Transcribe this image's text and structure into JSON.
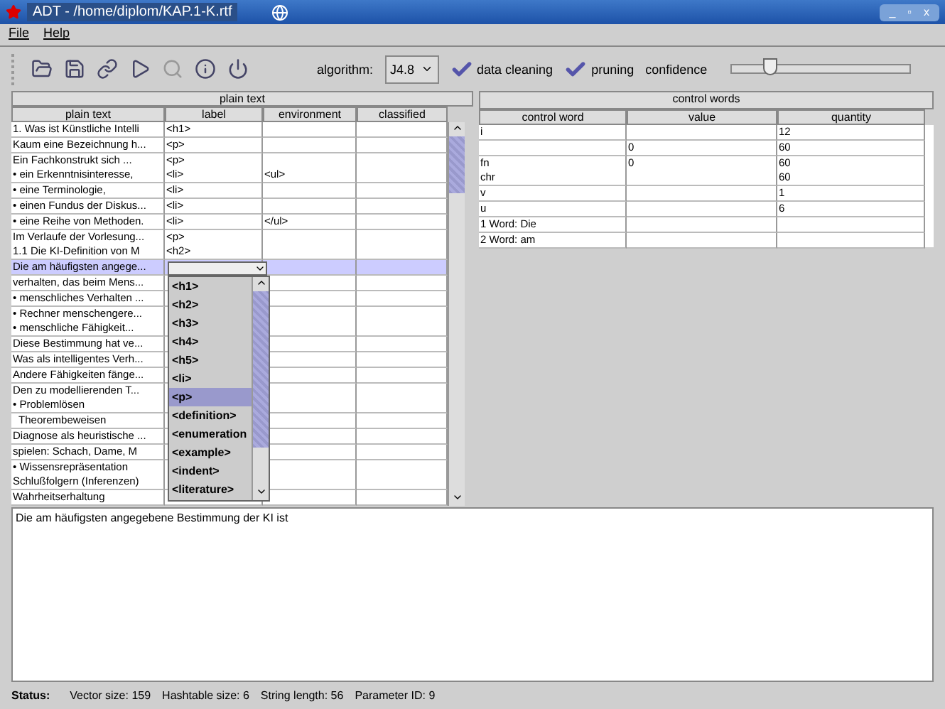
{
  "window": {
    "title": "ADT - /home/diplom/KAP.1-K.rtf",
    "controls": [
      "_",
      "▫",
      "x"
    ]
  },
  "menu": [
    "File",
    "Help"
  ],
  "toolbar": {
    "algorithm_label": "algorithm:",
    "algorithm": "J4.8",
    "options": [
      {
        "label": "data cleaning",
        "checked": true
      },
      {
        "label": "pruning",
        "checked": true
      }
    ],
    "confidence_label": "confidence",
    "confidence": {
      "level": 0.22
    }
  },
  "plain_text_table": {
    "title": "plain text",
    "columns": [
      "plain text",
      "label",
      "environment",
      "classified"
    ],
    "rows": [
      {
        "text": "1. Was ist Künstliche Intelli",
        "label": "<h1>",
        "environment": "",
        "selected": false
      },
      {
        "text": "Kaum eine Bezeichnung h...",
        "label": "<p>",
        "environment": "",
        "selected": false
      },
      {
        "text": "Ein Fachkonstrukt sich ...",
        "label": "<p>",
        "environment": "",
        "selected": false
      },
      {
        "text": "• ein Erkenntnisinteresse,",
        "label": "<li>",
        "environment": "<ul>",
        "selected": false
      },
      {
        "text": "• eine Terminologie,",
        "label": "<li>",
        "environment": "",
        "selected": false
      },
      {
        "text": "• einen Fundus der Diskus...",
        "label": "<li>",
        "environment": "",
        "selected": false
      },
      {
        "text": "• eine Reihe von Methoden.",
        "label": "<li>",
        "environment": "</ul>",
        "selected": false
      },
      {
        "text": "Im Verlaufe der Vorlesung...",
        "label": "<p>",
        "environment": "",
        "selected": false
      },
      {
        "text": "1.1 Die KI-Definition von M",
        "label": "<h2>",
        "environment": "",
        "selected": false
      },
      {
        "text": "Die am häufigsten angege...",
        "label": "",
        "environment": "",
        "selected": true
      },
      {
        "text": "verhalten, das beim Mens...",
        "selected": false
      },
      {
        "text": "• menschliches Verhalten ...",
        "selected": false
      },
      {
        "text": "• Rechner menschengere...",
        "selected": false
      },
      {
        "text": "• menschliche Fähigkeit...",
        "selected": false
      },
      {
        "text": "Diese Bestimmung hat ve...",
        "selected": false
      },
      {
        "text": "Was als intelligentes Verh...",
        "selected": false
      },
      {
        "text": "Andere Fähigkeiten fänge...",
        "selected": false
      },
      {
        "text": "Den zu modellierenden T...",
        "selected": false
      },
      {
        "text": "• Problemlösen",
        "selected": false
      },
      {
        "text": "  Theorembeweisen",
        "selected": false
      },
      {
        "text": "Diagnose als heuristische ...",
        "selected": false
      },
      {
        "text": "spielen: Schach, Dame, M",
        "selected": false
      },
      {
        "text": "• Wissensrepräsentation",
        "selected": false
      },
      {
        "text": "Schlußfolgern (Inferenzen)",
        "selected": false
      },
      {
        "text": "Wahrheitserhaltung",
        "selected": false
      }
    ],
    "label_dropdown": [
      {
        "label": "<h1>",
        "selected": false
      },
      {
        "label": "<h2>",
        "selected": false
      },
      {
        "label": "<h3>",
        "selected": false
      },
      {
        "label": "<h4>",
        "selected": false
      },
      {
        "label": "<h5>",
        "selected": false
      },
      {
        "label": "<li>",
        "selected": false
      },
      {
        "label": "<p>",
        "selected": true
      },
      {
        "label": "<definition>",
        "selected": false
      },
      {
        "label": "<enumeration",
        "selected": false
      },
      {
        "label": "<example>",
        "selected": false
      },
      {
        "label": "<indent>",
        "selected": false
      },
      {
        "label": "<literature>",
        "selected": false
      }
    ]
  },
  "control_words_table": {
    "title": "control words",
    "columns": [
      "control word",
      "value",
      "quantity"
    ],
    "rows": [
      [
        "i",
        "",
        "12"
      ],
      [
        "",
        "0",
        "60"
      ],
      [
        "fn",
        "0",
        "60"
      ],
      [
        "chr",
        "",
        "60"
      ],
      [
        "v",
        "",
        "1"
      ],
      [
        "u",
        "",
        "6"
      ],
      [
        "1 Word: Die",
        "",
        ""
      ],
      [
        "2 Word: am",
        "",
        ""
      ]
    ]
  },
  "text_area": "Die am häufigsten angegebene Bestimmung der KI ist",
  "status_bar": [
    "Status:",
    "Vector size: 159",
    "Hashtable size: 6",
    "String length: 56",
    "Parameter ID: 9"
  ]
}
